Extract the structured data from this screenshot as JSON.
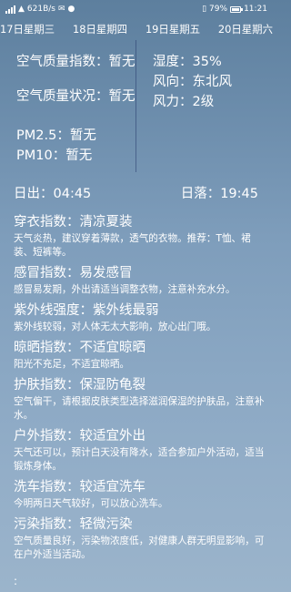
{
  "status": {
    "net_speed": "621B/s",
    "battery": "79%",
    "time": "11:21"
  },
  "days": [
    "17日星期三",
    "18日星期四",
    "19日星期五",
    "20日星期六"
  ],
  "air": {
    "aqi": "空气质量指数：暂无",
    "status": "空气质量状况：暂无",
    "pm25": "PM2.5：暂无",
    "pm10": "PM10：暂无"
  },
  "weather": {
    "humidity": "湿度：35%",
    "wind_dir": "风向：东北风",
    "wind_power": "风力：2级"
  },
  "sun": {
    "sunrise": "日出：04:45",
    "sunset": "日落：19:45"
  },
  "indices": [
    {
      "title": "穿衣指数：清凉夏装",
      "desc": "天气炎热，建议穿着薄款，透气的衣物。推荐：T恤、裙装、短裤等。"
    },
    {
      "title": "感冒指数：易发感冒",
      "desc": "感冒易发期，外出请适当调整衣物，注意补充水分。"
    },
    {
      "title": "紫外线强度：紫外线最弱",
      "desc": "紫外线较弱，对人体无太大影响，放心出门哦。"
    },
    {
      "title": "晾晒指数：不适宜晾晒",
      "desc": "阳光不充足，不适宜晾晒。"
    },
    {
      "title": "护肤指数：保湿防龟裂",
      "desc": "空气偏干，请根据皮肤类型选择滋润保湿的护肤品，注意补水。"
    },
    {
      "title": "户外指数：较适宜外出",
      "desc": "天气还可以，预计白天没有降水，适合参加户外活动，适当锻炼身体。"
    },
    {
      "title": "洗车指数：较适宜洗车",
      "desc": "今明两日天气较好，可以放心洗车。"
    },
    {
      "title": "污染指数：轻微污染",
      "desc": "空气质量良好，污染物浓度低，对健康人群无明显影响，可在户外适当活动。"
    }
  ],
  "more": ":"
}
